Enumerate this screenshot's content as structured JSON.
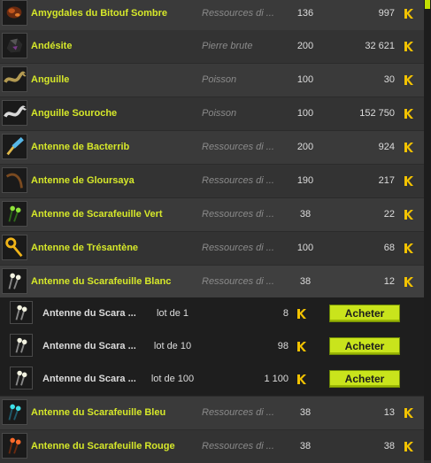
{
  "currency_icon": "kama-icon",
  "accent_color": "#d6e82a",
  "items": [
    {
      "name": "Amygdales du Bitouf Sombre",
      "type": "Ressources di ...",
      "level": "136",
      "price": "997",
      "icon": "amygdales-icon"
    },
    {
      "name": "Andésite",
      "type": "Pierre brute",
      "level": "200",
      "price": "32 621",
      "icon": "stone-icon"
    },
    {
      "name": "Anguille",
      "type": "Poisson",
      "level": "100",
      "price": "30",
      "icon": "eel-icon"
    },
    {
      "name": "Anguille Souroche",
      "type": "Poisson",
      "level": "100",
      "price": "152 750",
      "icon": "eel-silver-icon"
    },
    {
      "name": "Antenne de Bacterrib",
      "type": "Ressources di ...",
      "level": "200",
      "price": "924",
      "icon": "antenna-blue-icon"
    },
    {
      "name": "Antenne de Gloursaya",
      "type": "Ressources di ...",
      "level": "190",
      "price": "217",
      "icon": "antenna-brown-icon"
    },
    {
      "name": "Antenne de Scarafeuille Vert",
      "type": "Ressources di ...",
      "level": "38",
      "price": "22",
      "icon": "antenna-green-icon"
    },
    {
      "name": "Antenne de Trésantène",
      "type": "Ressources di ...",
      "level": "100",
      "price": "68",
      "icon": "antenna-gold-icon"
    },
    {
      "name": "Antenne du Scarafeuille Blanc",
      "type": "Ressources di ...",
      "level": "38",
      "price": "12",
      "icon": "antenna-white-icon"
    }
  ],
  "lots": [
    {
      "name": "Antenne du Scara ...",
      "lot": "lot de 1",
      "price": "8",
      "button": "Acheter"
    },
    {
      "name": "Antenne du Scara ...",
      "lot": "lot de 10",
      "price": "98",
      "button": "Acheter"
    },
    {
      "name": "Antenne du Scara ...",
      "lot": "lot de 100",
      "price": "1 100",
      "button": "Acheter"
    }
  ],
  "items_after": [
    {
      "name": "Antenne du Scarafeuille Bleu",
      "type": "Ressources di ...",
      "level": "38",
      "price": "13",
      "icon": "antenna-cyan-icon"
    },
    {
      "name": "Antenne du Scarafeuille Rouge",
      "type": "Ressources di ...",
      "level": "38",
      "price": "38",
      "icon": "antenna-red-icon"
    }
  ]
}
